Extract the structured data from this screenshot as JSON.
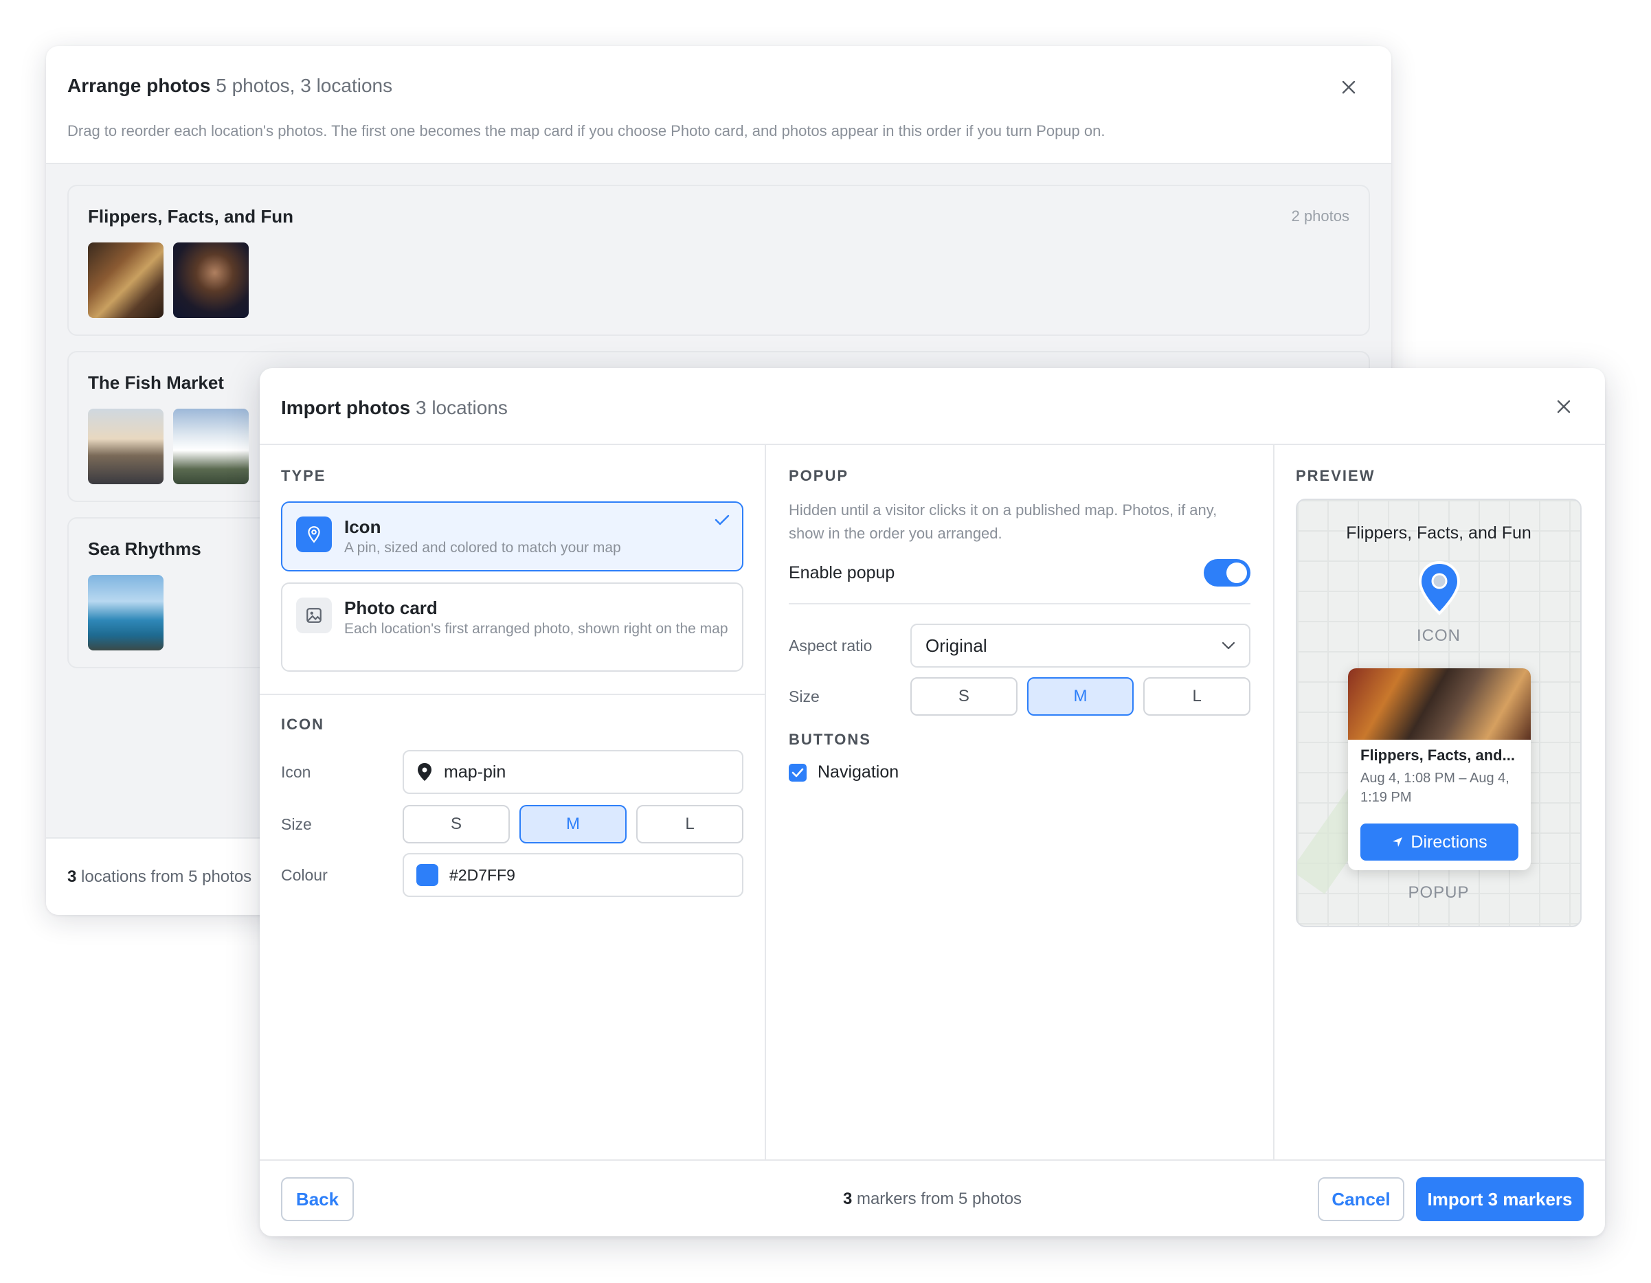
{
  "arrange": {
    "title": "Arrange photos",
    "subtitle": "5 photos, 3 locations",
    "description": "Drag to reorder each location's photos. The first one becomes the map card if you choose Photo card, and photos appear in this order if you turn Popup on.",
    "locations": [
      {
        "name": "Flippers, Facts, and Fun",
        "count": "2 photos"
      },
      {
        "name": "The Fish Market"
      },
      {
        "name": "Sea Rhythms"
      }
    ],
    "footer_count": "3",
    "footer_text": "locations from 5 photos"
  },
  "import": {
    "title": "Import photos",
    "subtitle": "3 locations",
    "type": {
      "label": "TYPE",
      "options": [
        {
          "title": "Icon",
          "desc": "A pin, sized and colored to match your map",
          "selected": true
        },
        {
          "title": "Photo card",
          "desc": "Each location's first arranged photo, shown right on the map",
          "selected": false
        }
      ]
    },
    "icon": {
      "label": "ICON",
      "icon_label": "Icon",
      "icon_value": "map-pin",
      "size_label": "Size",
      "sizes": [
        "S",
        "M",
        "L"
      ],
      "size_selected": "M",
      "colour_label": "Colour",
      "colour_value": "#2D7FF9"
    },
    "popup": {
      "label": "POPUP",
      "description": "Hidden until a visitor clicks it on a published map. Photos, if any, show in the order you arranged.",
      "enable_label": "Enable popup",
      "enabled": true,
      "aspect_label": "Aspect ratio",
      "aspect_value": "Original",
      "size_label": "Size",
      "sizes": [
        "S",
        "M",
        "L"
      ],
      "size_selected": "M",
      "buttons_label": "BUTTONS",
      "navigation_label": "Navigation",
      "navigation_checked": true
    },
    "preview": {
      "label": "PREVIEW",
      "pin_title": "Flippers, Facts, and Fun",
      "icon_caption": "ICON",
      "card_title": "Flippers, Facts, and...",
      "card_date": "Aug 4, 1:08 PM – Aug 4, 1:19 PM",
      "card_button": "Directions",
      "popup_caption": "POPUP"
    },
    "footer": {
      "back": "Back",
      "count": "3",
      "count_text": "markers from 5 photos",
      "cancel": "Cancel",
      "import": "Import 3 markers"
    }
  },
  "colors": {
    "accent": "#2D7FF9"
  }
}
